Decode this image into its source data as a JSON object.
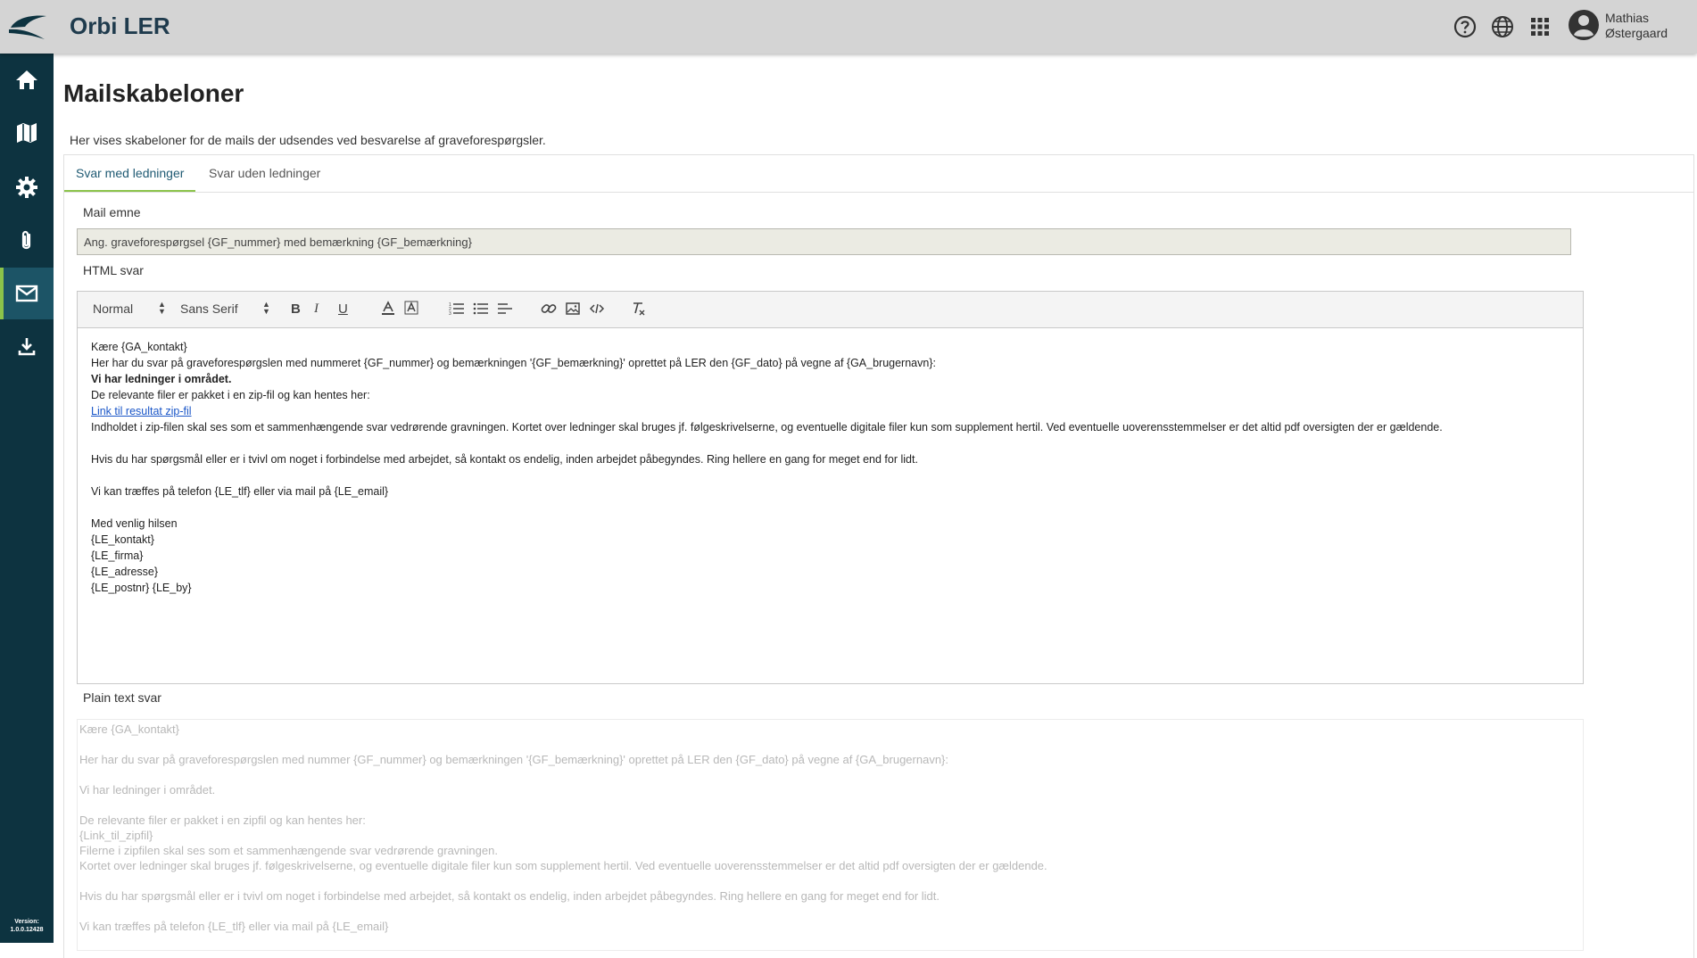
{
  "app": {
    "title": "Orbi LER",
    "version_label": "Version:",
    "version": "1.0.0.12428"
  },
  "user": {
    "first_name": "Mathias",
    "last_name": "Østergaard"
  },
  "topbar_icons": [
    "help-icon",
    "globe-icon",
    "apps-grid-icon",
    "user-avatar-icon"
  ],
  "sidebar_items": [
    {
      "name": "home",
      "icon": "home-icon",
      "active": false
    },
    {
      "name": "map",
      "icon": "map-icon",
      "active": false
    },
    {
      "name": "settings",
      "icon": "gear-icon",
      "active": false
    },
    {
      "name": "attachments",
      "icon": "paperclip-icon",
      "active": false
    },
    {
      "name": "mail",
      "icon": "mail-icon",
      "active": true
    },
    {
      "name": "download",
      "icon": "download-icon",
      "active": false
    }
  ],
  "page": {
    "title": "Mailskabeloner",
    "intro": "Her vises skabeloner for de mails der udsendes ved besvarelse af graveforespørgsler."
  },
  "tabs": [
    {
      "label": "Svar med ledninger",
      "active": true
    },
    {
      "label": "Svar uden ledninger",
      "active": false
    }
  ],
  "subject": {
    "label": "Mail emne",
    "value": "Ang. graveforespørgsel {GF_nummer} med bemærkning {GF_bemærkning}"
  },
  "html_reply": {
    "label": "HTML svar",
    "toolbar": {
      "header_select": "Normal",
      "font_select": "Sans Serif",
      "buttons": [
        "bold-icon",
        "italic-icon",
        "underline-icon",
        "text-color-icon",
        "background-color-icon",
        "ordered-list-icon",
        "bullet-list-icon",
        "align-icon",
        "link-icon",
        "image-icon",
        "code-icon",
        "clear-format-icon"
      ]
    },
    "lines": [
      "Kære {GA_kontakt}",
      "Her har du svar på graveforespørgslen med nummeret {GF_nummer} og bemærkningen '{GF_bemærkning}' oprettet på LER den {GF_dato} på vegne af {GA_brugernavn}:",
      "Vi har ledninger i området.",
      "De relevante filer er pakket i en zip-fil og kan hentes her:",
      "Link til resultat zip-fil",
      "Indholdet i zip-filen skal ses som et sammenhængende svar vedrørende gravningen. Kortet over ledninger skal bruges jf. følgeskrivelserne, og eventuelle digitale filer kun som supplement hertil. Ved eventuelle uoverensstemmelser er det altid pdf oversigten der er gældende.",
      "",
      "Hvis du har spørgsmål eller er i tvivl om noget i forbindelse med arbejdet, så kontakt os endelig, inden arbejdet påbegyndes. Ring hellere en gang for meget end for lidt.",
      "",
      "Vi kan træffes på telefon {LE_tlf} eller via mail på {LE_email}",
      "",
      "Med venlig hilsen",
      "{LE_kontakt}",
      "{LE_firma}",
      "{LE_adresse}",
      "{LE_postnr} {LE_by}"
    ]
  },
  "plain_reply": {
    "label": "Plain text svar",
    "lines": [
      "Kære {GA_kontakt}",
      "",
      "Her har du svar på graveforespørgslen med nummer {GF_nummer} og bemærkningen '{GF_bemærkning}' oprettet på LER den {GF_dato} på vegne af {GA_brugernavn}:",
      "",
      "Vi har ledninger i området.",
      "",
      "De relevante filer er pakket i en zipfil og kan hentes her:",
      "{Link_til_zipfil}",
      "Filerne i zipfilen skal ses som et sammenhængende svar vedrørende gravningen.",
      "Kortet over ledninger skal bruges jf. følgeskrivelserne, og eventuelle digitale filer kun som supplement hertil. Ved eventuelle uoverensstemmelser er det altid pdf oversigten der er gældende.",
      "",
      "Hvis du har spørgsmål eller er i tvivl om noget i forbindelse med arbejdet, så kontakt os endelig, inden arbejdet påbegyndes. Ring hellere en gang for meget end for lidt.",
      "",
      "Vi kan træffes på telefon {LE_tlf} eller via mail på {LE_email}"
    ]
  },
  "colors": {
    "sidebar": "#0d3340",
    "sidebar_active": "#1c5466",
    "accent": "#8bc34a",
    "topbar": "#d4d4d4",
    "link": "#1a56c8"
  }
}
